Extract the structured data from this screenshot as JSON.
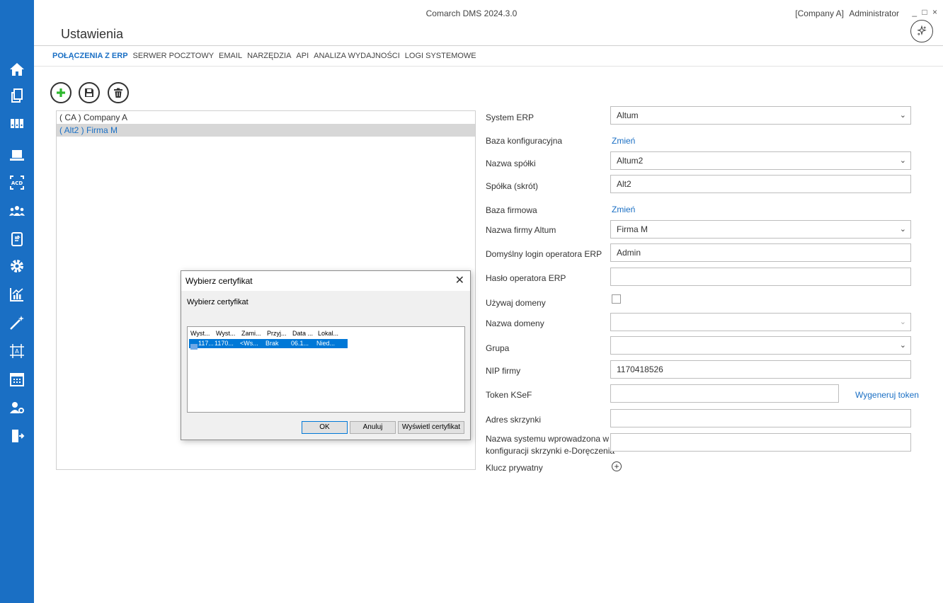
{
  "app": {
    "title": "Comarch DMS 2024.3.0",
    "company": "[Company A]",
    "user": "Administrator",
    "window_controls": "_ □ ×",
    "page_title": "Ustawienia"
  },
  "sidebar": {
    "items": [
      "home-icon",
      "documents-icon",
      "binders-icon",
      "computer-icon",
      "acd-scan-icon",
      "users-group-icon",
      "document-sync-icon",
      "settings-gear-icon",
      "chart-icon",
      "magic-wand-icon",
      "template-designer-icon",
      "calendar-icon",
      "user-settings-icon",
      "logout-icon"
    ],
    "color": "#1a6fc4"
  },
  "tabs": [
    {
      "label": "POŁĄCZENIA Z ERP",
      "active": true
    },
    {
      "label": "SERWER POCZTOWY"
    },
    {
      "label": "EMAIL"
    },
    {
      "label": "NARZĘDZIA"
    },
    {
      "label": "API"
    },
    {
      "label": "ANALIZA WYDAJNOŚCI"
    },
    {
      "label": "LOGI SYSTEMOWE"
    }
  ],
  "companies": [
    {
      "label": "( CA ) Company A",
      "selected": false
    },
    {
      "label": "( Alt2 ) Firma M",
      "selected": true
    }
  ],
  "form": {
    "system_erp": {
      "label": "System ERP",
      "value": "Altum"
    },
    "baza_konfiguracyjna": {
      "label": "Baza konfiguracyjna",
      "link": "Zmień"
    },
    "nazwa_spolki": {
      "label": "Nazwa spółki",
      "value": "Altum2"
    },
    "spolka_skrot": {
      "label": "Spółka (skrót)",
      "value": "Alt2"
    },
    "baza_firmowa": {
      "label": "Baza firmowa",
      "link": "Zmień"
    },
    "nazwa_firmy": {
      "label": "Nazwa firmy Altum",
      "value": "Firma M"
    },
    "login": {
      "label": "Domyślny login operatora ERP",
      "value": "Admin"
    },
    "haslo": {
      "label": "Hasło operatora ERP",
      "value": ""
    },
    "uzywaj_domeny": {
      "label": "Używaj domeny",
      "checked": false
    },
    "nazwa_domeny": {
      "label": "Nazwa domeny",
      "value": ""
    },
    "grupa": {
      "label": "Grupa",
      "value": ""
    },
    "nip": {
      "label": "NIP firmy",
      "value": "1170418526"
    },
    "token": {
      "label": "Token KSeF",
      "value": "",
      "action": "Wygeneruj token"
    },
    "adres_skrzynki": {
      "label": "Adres skrzynki",
      "value": ""
    },
    "nazwa_systemu": {
      "label_line1": "Nazwa systemu wprowadzona w",
      "label_line2": "konfiguracji skrzynki e-Doręczenia",
      "value": ""
    },
    "klucz": {
      "label": "Klucz prywatny"
    }
  },
  "dialog": {
    "title": "Wybierz certyfikat",
    "close": "✕",
    "subtitle": "Wybierz certyfikat",
    "headers": [
      "Wyst...",
      "Wyst...",
      "Zami...",
      "Przyj...",
      "Data ...",
      "Lokal..."
    ],
    "row": [
      "117...",
      "1170...",
      "<Ws...",
      "Brak",
      "06.1...",
      "Nied..."
    ],
    "ok": "OK",
    "cancel": "Anuluj",
    "show": "Wyświetl certyfikat"
  }
}
